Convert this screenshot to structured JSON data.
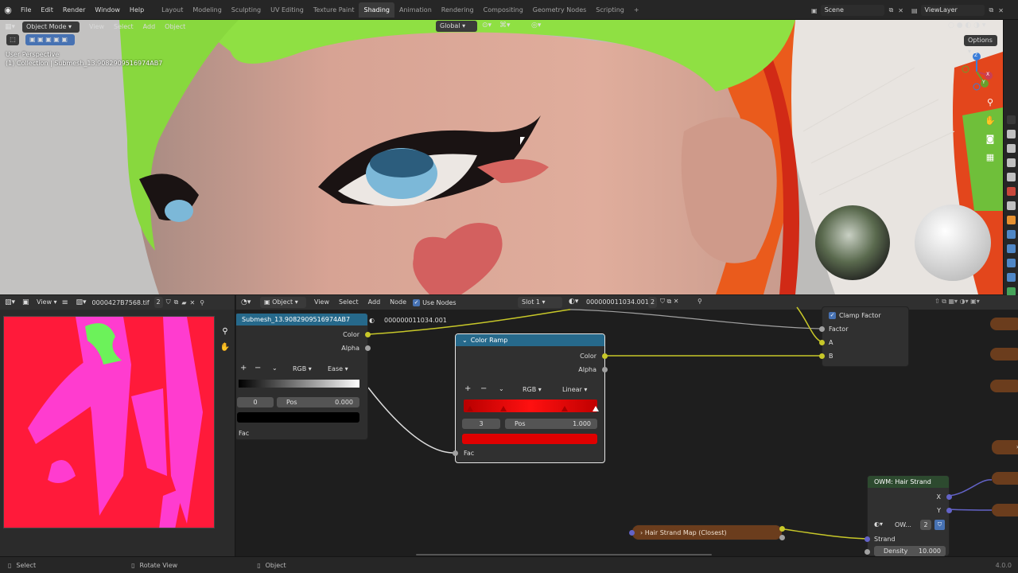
{
  "menu": {
    "items": [
      "File",
      "Edit",
      "Render",
      "Window",
      "Help"
    ],
    "workspaces": [
      "Layout",
      "Modeling",
      "Sculpting",
      "UV Editing",
      "Texture Paint",
      "Shading",
      "Animation",
      "Rendering",
      "Compositing",
      "Geometry Nodes",
      "Scripting"
    ],
    "active_workspace": "Shading",
    "scene": "Scene",
    "view_layer": "ViewLayer"
  },
  "viewport": {
    "mode": "Object Mode",
    "menus": [
      "View",
      "Select",
      "Add",
      "Object"
    ],
    "transform": "Global",
    "options": "Options",
    "overlay_line1": "User Perspective",
    "overlay_line2": "(1) Collection | Submesh_13.9082909516974AB7",
    "gizmo_x": "X",
    "gizmo_y": "Y",
    "gizmo_z": "Z"
  },
  "image_editor": {
    "view_label": "View",
    "image_name": "0000427B7568.tif",
    "users": "2"
  },
  "node_editor": {
    "object_label": "Object",
    "menus": [
      "View",
      "Select",
      "Add",
      "Node"
    ],
    "use_nodes": "Use Nodes",
    "slot": "Slot 1",
    "material": "000000011034.001",
    "users": "2",
    "texture_node": {
      "title": "Submesh_13.9082909516974AB7",
      "material_field": "000000011034.001",
      "out_color": "Color",
      "out_alpha": "Alpha"
    },
    "left_ramp": {
      "mode": "RGB",
      "interp": "Ease",
      "index": "0",
      "pos_label": "Pos",
      "pos_value": "0.000",
      "fac": "Fac"
    },
    "color_ramp": {
      "title": "Color Ramp",
      "out_color": "Color",
      "out_alpha": "Alpha",
      "mode": "RGB",
      "interp": "Linear",
      "index": "3",
      "pos_label": "Pos",
      "pos_value": "1.000",
      "fac": "Fac"
    },
    "mix_node": {
      "clamp": "Clamp Factor",
      "factor": "Factor",
      "a": "A",
      "b": "B"
    },
    "hair_node": {
      "title": "OWM: Hair Strand",
      "x": "X",
      "y": "Y",
      "group": "OW...",
      "users": "2",
      "strand": "Strand",
      "density_label": "Density",
      "density_value": "10.000"
    },
    "hair_map": {
      "title": "Hair Strand Map (Closest)"
    }
  },
  "statusbar": {
    "select": "Select",
    "rotate": "Rotate View",
    "object": "Object",
    "version": "4.0.0"
  },
  "colors": {
    "accent": "#4772b3",
    "node_header_blue": "#26698b",
    "ramp_red": "#e00000",
    "texture_red": "#ff1a3a",
    "texture_magenta": "#ff3ccf",
    "texture_green": "#6cf25a"
  }
}
